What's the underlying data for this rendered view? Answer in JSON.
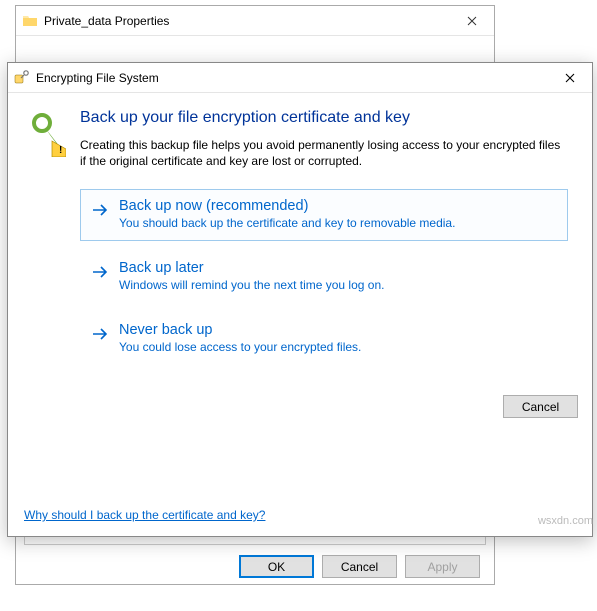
{
  "props_window": {
    "title": "Private_data Properties",
    "buttons": {
      "ok": "OK",
      "cancel": "Cancel",
      "apply": "Apply"
    }
  },
  "efs_dialog": {
    "title": "Encrypting File System",
    "heading": "Back up your file encryption certificate and key",
    "description": "Creating this backup file helps you avoid permanently losing access to your encrypted files if the original certificate and key are lost or corrupted.",
    "options": [
      {
        "title": "Back up now (recommended)",
        "sub": "You should back up the certificate and key to removable media."
      },
      {
        "title": "Back up later",
        "sub": "Windows will remind you the next time you log on."
      },
      {
        "title": "Never back up",
        "sub": "You could lose access to your encrypted files."
      }
    ],
    "cancel": "Cancel",
    "help_link": "Why should I back up the certificate and key?"
  },
  "watermark": "wsxdn.com"
}
